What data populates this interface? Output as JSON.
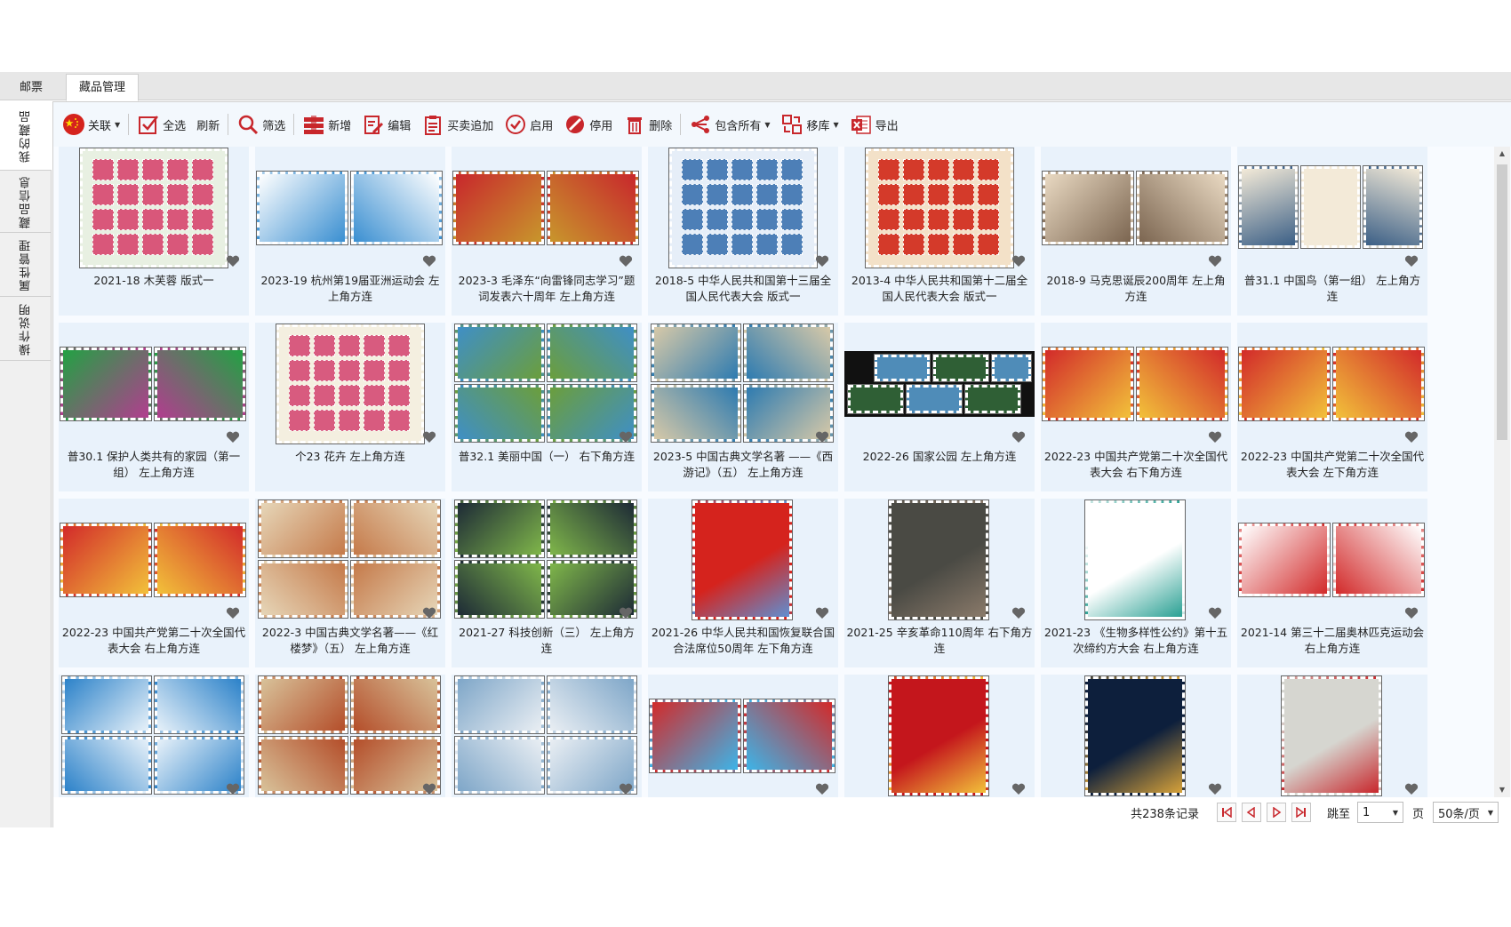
{
  "top_tabs": [
    "邮票",
    "藏品管理"
  ],
  "left_tabs": [
    "我的藏品",
    "藏品信息",
    "属性管理",
    "操作说明"
  ],
  "toolbar": {
    "link": "关联",
    "select_all": "全选",
    "refresh": "刷新",
    "filter": "筛选",
    "add": "新增",
    "edit": "编辑",
    "trade_append": "买卖追加",
    "enable": "启用",
    "disable": "停用",
    "delete": "删除",
    "include_all": "包含所有",
    "move": "移库",
    "export": "导出"
  },
  "items": [
    {
      "caption": "2021-18 木芙蓉 版式一",
      "icon": "sheet-stamp",
      "colors": [
        "#e8f0e2",
        "#d9577a"
      ]
    },
    {
      "caption": "2023-19 杭州第19届亚洲运动会 左上角方连",
      "icon": "pair-stamp",
      "colors": [
        "#ffffff",
        "#3a8fd1"
      ]
    },
    {
      "caption": "2023-3 毛泽东“向雷锋同志学习”题词发表六十周年 左上角方连",
      "icon": "pair-stamp",
      "colors": [
        "#c8272c",
        "#c8962c"
      ]
    },
    {
      "caption": "2018-5 中华人民共和国第十三届全国人民代表大会 版式一",
      "icon": "sheet-stamp",
      "colors": [
        "#e6eef8",
        "#4d7fb7"
      ]
    },
    {
      "caption": "2013-4 中华人民共和国第十二届全国人民代表大会 版式一",
      "icon": "sheet-stamp",
      "colors": [
        "#f3e1c8",
        "#d43a2a"
      ]
    },
    {
      "caption": "2018-9 马克思诞辰200周年 左上角方连",
      "icon": "pair-stamp",
      "colors": [
        "#e9d9c2",
        "#7c6651"
      ]
    },
    {
      "caption": "普31.1 中国鸟（第一组） 左上角方连",
      "icon": "triple-stamp",
      "colors": [
        "#f3ead8",
        "#3b5f86"
      ]
    },
    {
      "caption": "普30.1 保护人类共有的家园（第一组） 左上角方连",
      "icon": "pair-stamp",
      "colors": [
        "#22a143",
        "#b23d8f"
      ]
    },
    {
      "caption": "个23 花卉 左上角方连",
      "icon": "sheet-stamp",
      "colors": [
        "#f4efe0",
        "#d85b7f"
      ]
    },
    {
      "caption": "普32.1 美丽中国（一） 右下角方连",
      "icon": "block-stamp",
      "colors": [
        "#3f8fc6",
        "#6b9e3d"
      ]
    },
    {
      "caption": "2023-5 中国古典文学名著 ——《西游记》（五） 左上角方连",
      "icon": "block-stamp",
      "colors": [
        "#d7c9a8",
        "#2e7bb0"
      ]
    },
    {
      "caption": "2022-26 国家公园 左上角方连",
      "icon": "strip-stamp",
      "colors": [
        "#4f8cb8",
        "#2f5f35"
      ]
    },
    {
      "caption": "2022-23 中国共产党第二十次全国代表大会 右下角方连",
      "icon": "pair-stamp",
      "colors": [
        "#d22a2a",
        "#f2c13a"
      ]
    },
    {
      "caption": "2022-23 中国共产党第二十次全国代表大会 左下角方连",
      "icon": "pair-stamp",
      "colors": [
        "#d22a2a",
        "#f2c13a"
      ]
    },
    {
      "caption": "2022-23 中国共产党第二十次全国代表大会 右上角方连",
      "icon": "pair-stamp",
      "colors": [
        "#d22a2a",
        "#f2c13a"
      ]
    },
    {
      "caption": "2022-3 中国古典文学名著——《红楼梦》（五） 左上角方连",
      "icon": "block-stamp",
      "colors": [
        "#e6d6b8",
        "#c57a4a"
      ]
    },
    {
      "caption": "2021-27 科技创新（三） 左上角方连",
      "icon": "block-stamp",
      "colors": [
        "#1d2a36",
        "#7fb64a"
      ]
    },
    {
      "caption": "2021-26 中华人民共和国恢复联合国合法席位50周年 左下角方连",
      "icon": "single-stamp",
      "colors": [
        "#d5231d",
        "#5f8fd1"
      ]
    },
    {
      "caption": "2021-25 辛亥革命110周年 右下角方连",
      "icon": "single-stamp",
      "colors": [
        "#4a4a44",
        "#8a7a6a"
      ]
    },
    {
      "caption": "2021-23 《生物多样性公约》第十五次缔约方大会 右上角方连",
      "icon": "single-stamp",
      "colors": [
        "#ffffff",
        "#2aa093"
      ]
    },
    {
      "caption": "2021-14 第三十二届奥林匹克运动会 右上角方连",
      "icon": "pair-stamp",
      "colors": [
        "#ffffff",
        "#d22a2a"
      ]
    },
    {
      "caption": "",
      "icon": "block-stamp",
      "colors": [
        "#2c82c9",
        "#e7f1f9"
      ]
    },
    {
      "caption": "",
      "icon": "block-stamp",
      "colors": [
        "#d8c29a",
        "#b44e2a"
      ]
    },
    {
      "caption": "",
      "icon": "block-stamp",
      "colors": [
        "#7ea6c8",
        "#e9eef3"
      ]
    },
    {
      "caption": "",
      "icon": "pair-stamp",
      "colors": [
        "#d22a2a",
        "#3db4e8"
      ]
    },
    {
      "caption": "",
      "icon": "single-stamp",
      "colors": [
        "#c4161c",
        "#f2c13a"
      ]
    },
    {
      "caption": "",
      "icon": "single-stamp",
      "colors": [
        "#0d1f3c",
        "#d7a23a"
      ]
    },
    {
      "caption": "",
      "icon": "single-stamp",
      "colors": [
        "#d6d6d0",
        "#c8272c"
      ]
    }
  ],
  "pager": {
    "total": "共238条记录",
    "jump_label": "跳至",
    "page_value": "1",
    "page_unit": "页",
    "page_size": "50条/页"
  }
}
